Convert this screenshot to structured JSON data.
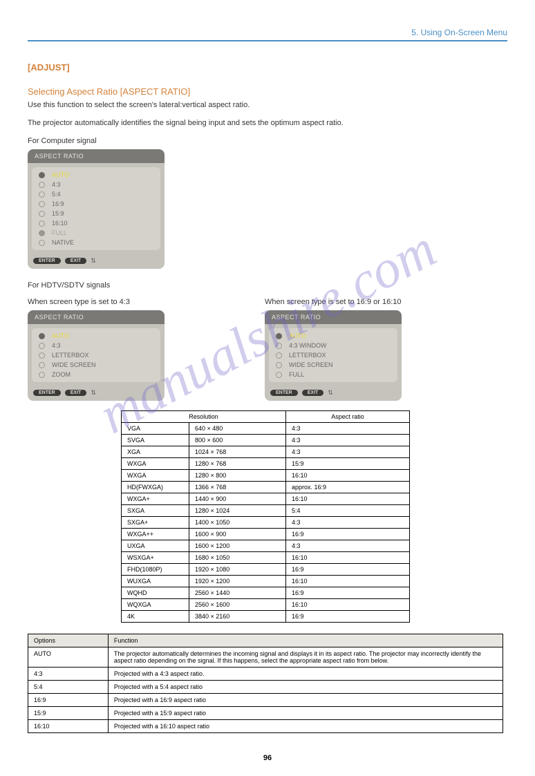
{
  "header": {
    "section": "5. Using On-Screen Menu"
  },
  "menu_path": "[ADJUST]",
  "section1": {
    "title": "Selecting Aspect Ratio [ASPECT RATIO]",
    "body": "Use this function to select the screen's lateral:vertical aspect ratio."
  },
  "body_text2": "The projector automatically identifies the signal being input and sets the optimum aspect ratio.",
  "sub1": "For Computer signal",
  "sub2": "For HDTV/SDTV signals",
  "osd_title": "ASPECT RATIO",
  "osd_enter": "ENTER",
  "osd_exit": "EXIT",
  "osd_arrows": "⇅",
  "osd1_items": [
    "AUTO",
    "4:3",
    "5:4",
    "16:9",
    "15:9",
    "16:10",
    "FULL",
    "NATIVE"
  ],
  "osd2_items": [
    "AUTO",
    "4:3",
    "LETTERBOX",
    "WIDE SCREEN",
    "ZOOM"
  ],
  "osd3_items": [
    "AUTO",
    "4:3 WINDOW",
    "LETTERBOX",
    "WIDE SCREEN",
    "FULL"
  ],
  "osd2_caption": "When screen type is set to 4:3",
  "osd3_caption": "When screen type is set to 16:9 or 16:10",
  "res_table_header": {
    "c1": "Resolution",
    "c2": "Aspect ratio"
  },
  "res_rows": [
    {
      "a": "VGA",
      "b": "640 × 480",
      "c": "4:3"
    },
    {
      "a": "SVGA",
      "b": "800 × 600",
      "c": "4:3"
    },
    {
      "a": "XGA",
      "b": "1024 × 768",
      "c": "4:3"
    },
    {
      "a": "WXGA",
      "b": "1280 × 768",
      "c": "15:9"
    },
    {
      "a": "WXGA",
      "b": "1280 × 800",
      "c": "16:10"
    },
    {
      "a": "HD(FWXGA)",
      "b": "1366 × 768",
      "c": "approx. 16:9"
    },
    {
      "a": "WXGA+",
      "b": "1440 × 900",
      "c": "16:10"
    },
    {
      "a": "SXGA",
      "b": "1280 × 1024",
      "c": "5:4"
    },
    {
      "a": "SXGA+",
      "b": "1400 × 1050",
      "c": "4:3"
    },
    {
      "a": "WXGA++",
      "b": "1600 × 900",
      "c": "16:9"
    },
    {
      "a": "UXGA",
      "b": "1600 × 1200",
      "c": "4:3"
    },
    {
      "a": "WSXGA+",
      "b": "1680 × 1050",
      "c": "16:10"
    },
    {
      "a": "FHD(1080P)",
      "b": "1920 × 1080",
      "c": "16:9"
    },
    {
      "a": "WUXGA",
      "b": "1920 × 1200",
      "c": "16:10"
    },
    {
      "a": "WQHD",
      "b": "2560 × 1440",
      "c": "16:9"
    },
    {
      "a": "WQXGA",
      "b": "2560 × 1600",
      "c": "16:10"
    },
    {
      "a": "4K",
      "b": "3840 × 2160",
      "c": "16:9"
    }
  ],
  "asp_table": {
    "h1": "Options",
    "h2": "Function",
    "rows": [
      {
        "a": "AUTO",
        "b": "The projector automatically determines the incoming signal and displays it in its aspect ratio. The projector may incorrectly identify the aspect ratio depending on the signal. If this happens, select the appropriate aspect ratio from below."
      },
      {
        "a": "4:3",
        "b": "Projected with a 4:3 aspect ratio."
      },
      {
        "a": "5:4",
        "b": "Projected with a 5:4 aspect ratio"
      },
      {
        "a": "16:9",
        "b": "Projected with a 16:9 aspect ratio"
      },
      {
        "a": "15:9",
        "b": "Projected with a 15:9 aspect ratio"
      },
      {
        "a": "16:10",
        "b": "Projected with a 16:10 aspect ratio"
      }
    ]
  },
  "watermark": "manualshire.com",
  "page_number": "96"
}
